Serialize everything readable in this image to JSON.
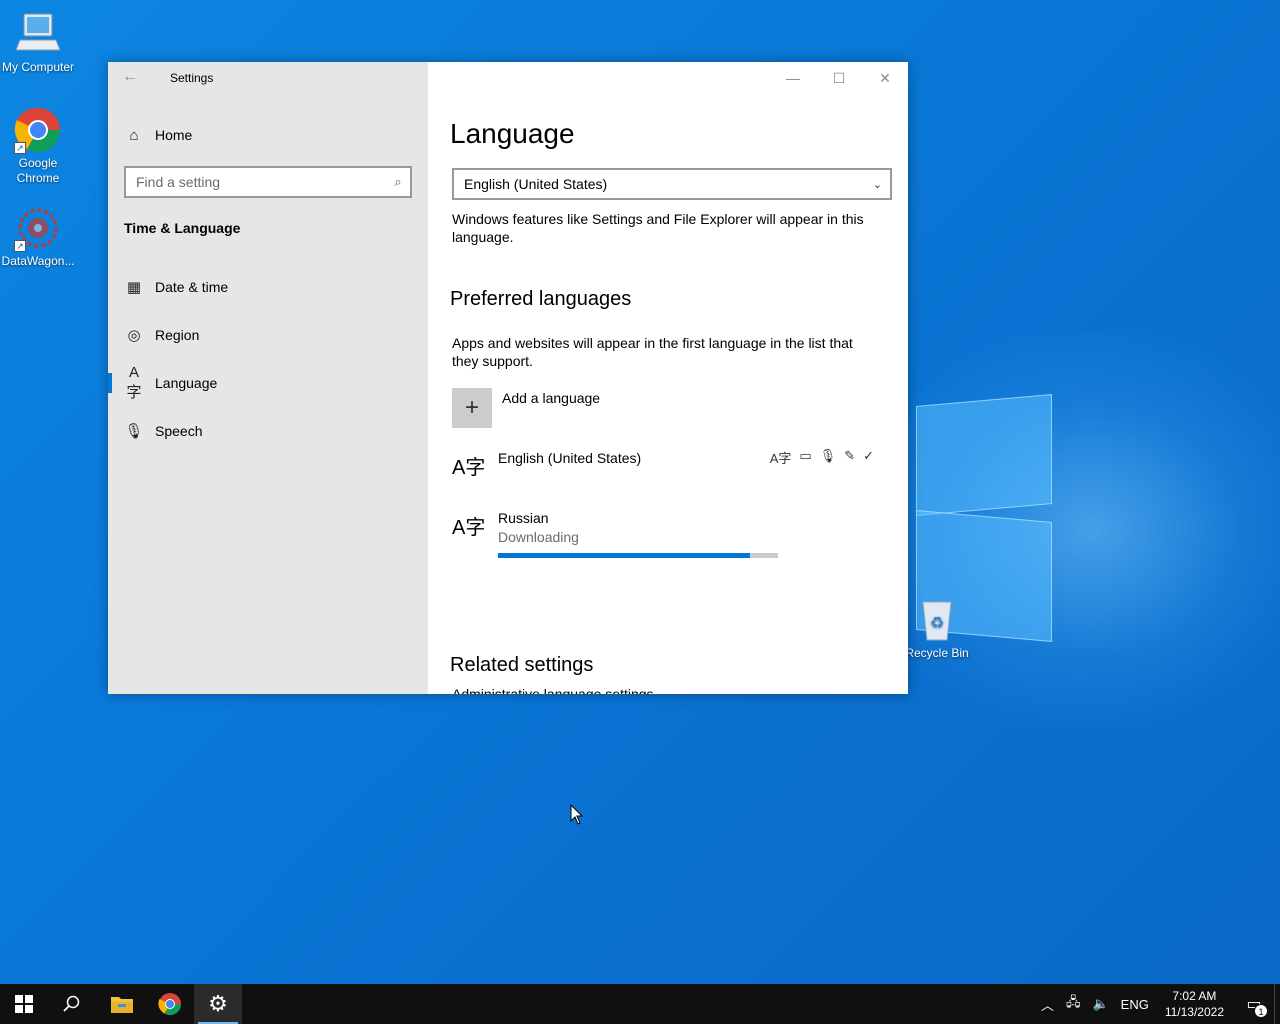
{
  "desktop": {
    "icons": [
      {
        "label": "My Computer",
        "icon": "computer-icon"
      },
      {
        "label": "Google Chrome",
        "icon": "chrome-icon"
      },
      {
        "label": "DataWagon...",
        "icon": "datawagon-icon"
      },
      {
        "label": "Recycle Bin",
        "icon": "recycle-bin-icon"
      }
    ]
  },
  "window": {
    "title": "Settings",
    "sidebar": {
      "home_label": "Home",
      "search_placeholder": "Find a setting",
      "section_heading": "Time & Language",
      "items": [
        {
          "label": "Date & time",
          "icon": "calendar-clock-icon"
        },
        {
          "label": "Region",
          "icon": "globe-icon"
        },
        {
          "label": "Language",
          "icon": "language-icon",
          "active": true
        },
        {
          "label": "Speech",
          "icon": "microphone-icon"
        }
      ]
    },
    "content": {
      "title": "Language",
      "display_language": "English (United States)",
      "display_language_desc": "Windows features like Settings and File Explorer will appear in this language.",
      "preferred_heading": "Preferred languages",
      "preferred_desc": "Apps and websites will appear in the first language in the list that they support.",
      "add_language_label": "Add a language",
      "languages": [
        {
          "name": "English (United States)",
          "status": "",
          "feature_icons": [
            "display-language-icon",
            "text-to-speech-icon",
            "speech-icon",
            "handwriting-icon",
            "spellcheck-icon"
          ]
        },
        {
          "name": "Russian",
          "status": "Downloading",
          "progress": 0.9
        }
      ],
      "related_heading": "Related settings",
      "related_link_partial": "Administrative language settings"
    }
  },
  "taskbar": {
    "apps": [
      "start-icon",
      "search-icon",
      "file-explorer-icon",
      "chrome-icon",
      "settings-icon"
    ],
    "active_app": "settings-icon",
    "tray": {
      "input_language": "ENG",
      "time": "7:02 AM",
      "date": "11/13/2022",
      "notification_count": "1"
    }
  },
  "colors": {
    "accent": "#0078d7",
    "sidebar_bg": "#e6e6e6",
    "taskbar_bg": "#101010"
  }
}
